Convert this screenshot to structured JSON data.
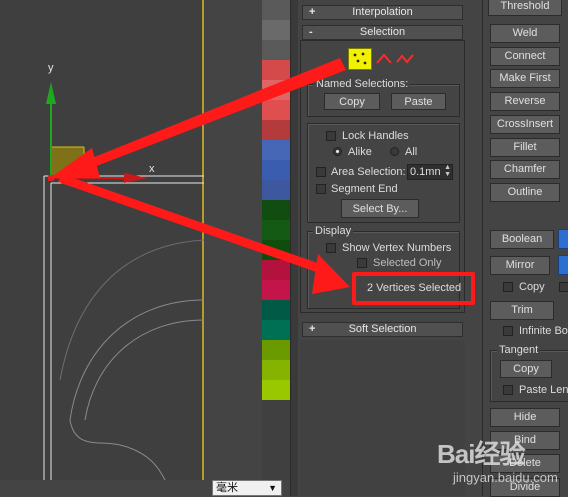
{
  "viewport": {
    "axis_y_label": "y",
    "axis_x_label": "x",
    "units_dropdown": "毫米"
  },
  "palette_swatches": [
    "#5a5a5a",
    "#6a6a6a",
    "#5a5a5a",
    "#d44a4a",
    "#e06666",
    "#e04f4f",
    "#b43b3b",
    "#4567b5",
    "#3b5db0",
    "#3e58a0",
    "#114d11",
    "#145a14",
    "#0f4d0f",
    "#b3123e",
    "#c3154a",
    "#005a45",
    "#007055",
    "#6a9a00",
    "#86b300",
    "#9ac800"
  ],
  "rollouts": {
    "interpolation": {
      "sign": "+",
      "label": "Interpolation"
    },
    "selection": {
      "sign": "-",
      "label": "Selection"
    },
    "soft_selection": {
      "sign": "+",
      "label": "Soft Selection"
    }
  },
  "named_selections": {
    "title": "Named Selections:",
    "copy_label": "Copy",
    "paste_label": "Paste"
  },
  "selection_options": {
    "lock_handles": "Lock Handles",
    "alike": "Alike",
    "all": "All",
    "area_selection": "Area Selection:",
    "area_value": "0.1mn",
    "segment_end": "Segment End",
    "select_by": "Select By..."
  },
  "display": {
    "title": "Display",
    "show_vertex_numbers": "Show Vertex Numbers",
    "selected_only": "Selected Only",
    "status": "2 Vertices Selected"
  },
  "right_panel": {
    "threshold": "Threshold",
    "weld": "Weld",
    "connect": "Connect",
    "make_first": "Make First",
    "reverse": "Reverse",
    "crossinsert": "CrossInsert",
    "fillet": "Fillet",
    "chamfer": "Chamfer",
    "outline": "Outline",
    "boolean": "Boolean",
    "mirror": "Mirror",
    "copy_check": "Copy",
    "trim": "Trim",
    "infinite_bounds": "Infinite Bo",
    "tangent_title": "Tangent",
    "tangent_copy": "Copy",
    "paste_length": "Paste Leng",
    "hide": "Hide",
    "bind": "Bind",
    "delete": "Delete",
    "divide": "Divide"
  },
  "watermark": {
    "text": "Bai经验",
    "url": "jingyan.baidu.com"
  },
  "colors": {
    "accent_red": "#ff1a1a",
    "vertex_icon_yellow": "#f2f200",
    "axis_green": "#1fa81f",
    "axis_red": "#c81a1a"
  }
}
